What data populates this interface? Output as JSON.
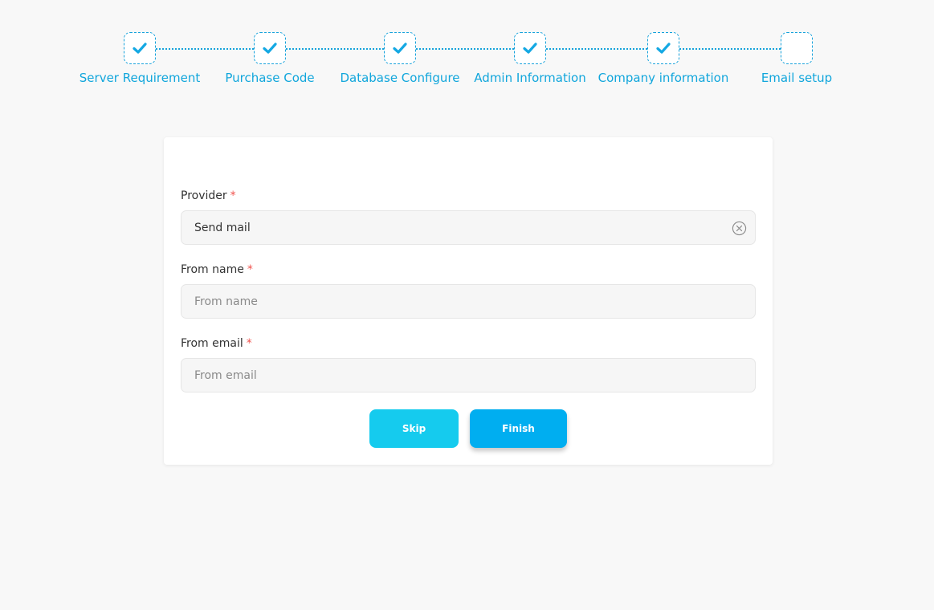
{
  "stepper": {
    "steps": [
      {
        "label": "Server Requirement",
        "completed": true
      },
      {
        "label": "Purchase Code",
        "completed": true
      },
      {
        "label": "Database Configure",
        "completed": true
      },
      {
        "label": "Admin Information",
        "completed": true
      },
      {
        "label": "Company information",
        "completed": true
      },
      {
        "label": "Email setup",
        "completed": false
      }
    ],
    "accent_color": "#11a6dc"
  },
  "form": {
    "provider": {
      "label": "Provider",
      "required_mark": "*",
      "value": "Send mail"
    },
    "from_name": {
      "label": "From name",
      "required_mark": "*",
      "value": "",
      "placeholder": "From name"
    },
    "from_email": {
      "label": "From email",
      "required_mark": "*",
      "value": "",
      "placeholder": "From email"
    }
  },
  "actions": {
    "skip_label": "Skip",
    "finish_label": "Finish"
  },
  "icons": {
    "check": "check-icon",
    "clear": "circle-x-icon"
  }
}
